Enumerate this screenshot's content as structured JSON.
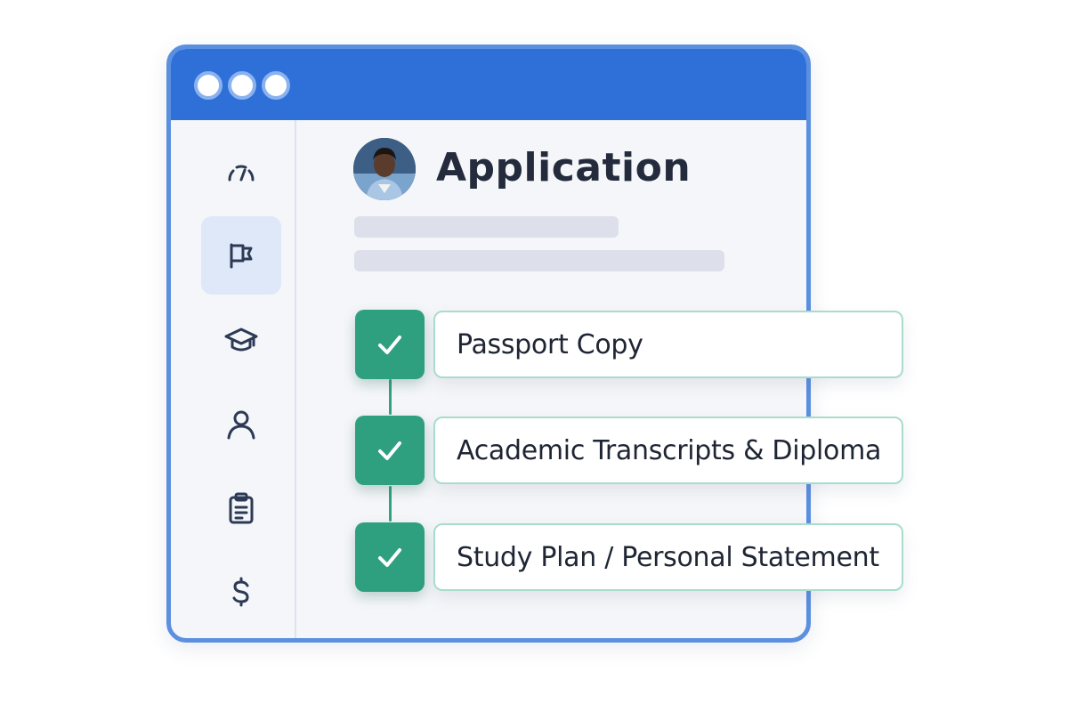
{
  "window": {
    "title_dots": [
      "dot-1",
      "dot-2",
      "dot-3"
    ],
    "accent_color": "#2f6fd8",
    "border_color": "#5b8fe0"
  },
  "sidebar": {
    "items": [
      {
        "name": "dashboard",
        "icon": "gauge-icon",
        "active": false
      },
      {
        "name": "flag",
        "icon": "flag-icon",
        "active": true
      },
      {
        "name": "education",
        "icon": "graduation-cap-icon",
        "active": false
      },
      {
        "name": "profile",
        "icon": "user-icon",
        "active": false
      },
      {
        "name": "documents",
        "icon": "clipboard-icon",
        "active": false
      },
      {
        "name": "payments",
        "icon": "dollar-icon",
        "active": false
      }
    ],
    "active_color": "#dfe8f8"
  },
  "header": {
    "title": "Application",
    "avatar_icon": "user-avatar"
  },
  "checklist": {
    "check_color": "#2fa07f",
    "items": [
      {
        "label": "Passport Copy",
        "status": "complete"
      },
      {
        "label": "Academic Transcripts & Diploma",
        "status": "complete"
      },
      {
        "label": "Study Plan / Personal Statement",
        "status": "complete"
      }
    ]
  }
}
